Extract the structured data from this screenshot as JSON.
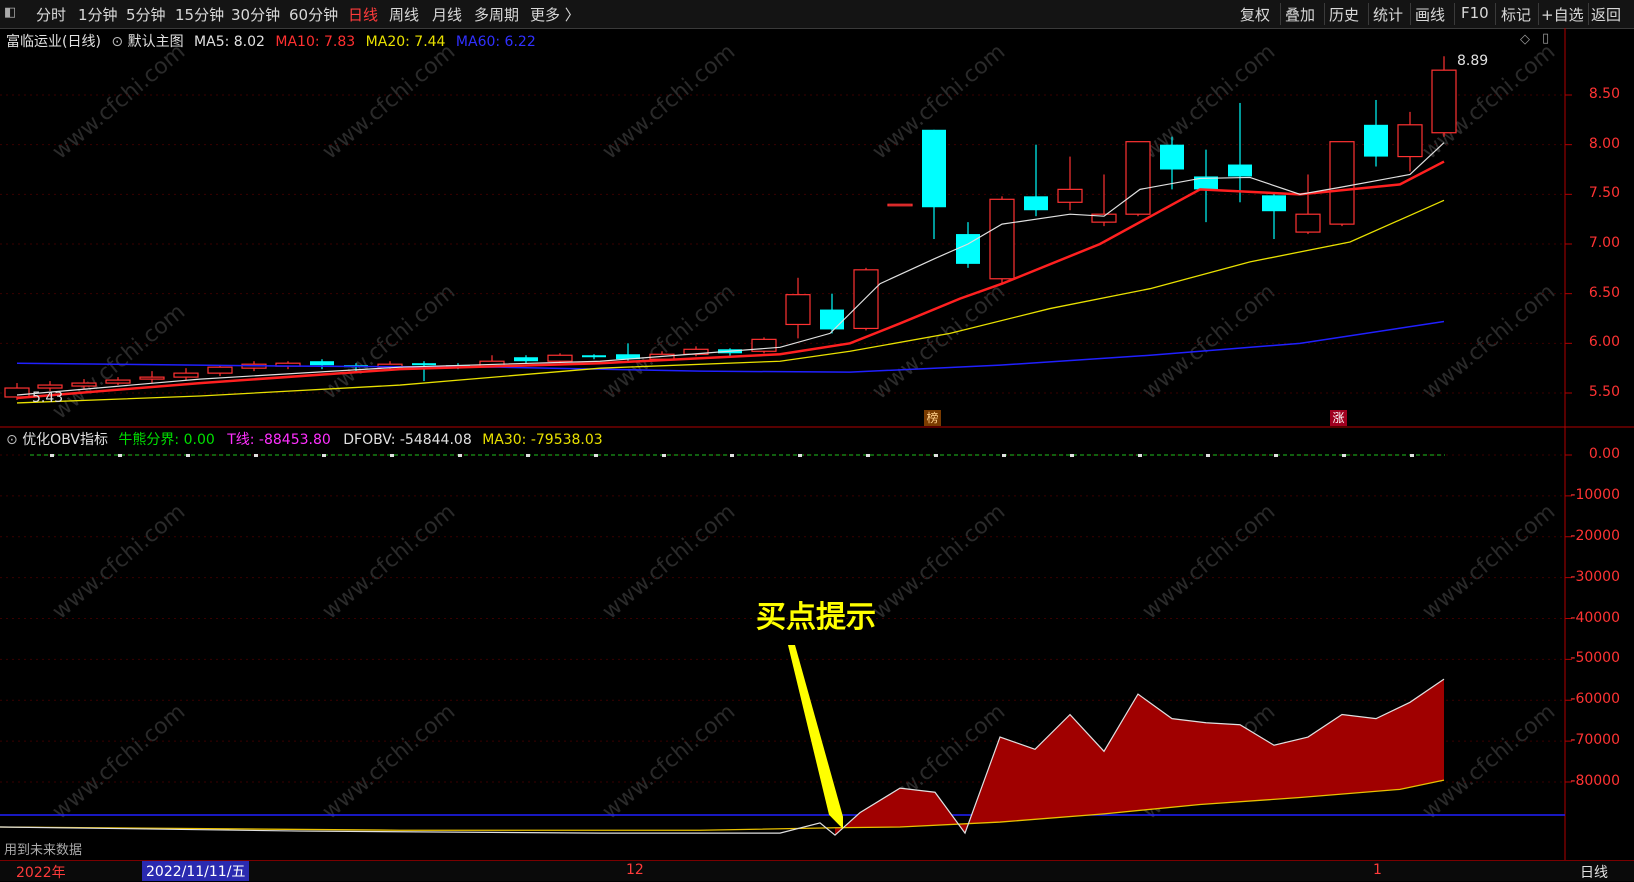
{
  "toolbar": {
    "left_icon": "layout-toggle-icon",
    "periods": [
      "分时",
      "1分钟",
      "5分钟",
      "15分钟",
      "30分钟",
      "60分钟",
      "日线",
      "周线",
      "月线",
      "多周期",
      "更多 〉"
    ],
    "active_period": "日线",
    "right_buttons": [
      "复权",
      "叠加",
      "历史",
      "统计",
      "画线",
      "F10",
      "标记",
      "+自选",
      "返回"
    ]
  },
  "main_chart": {
    "stock_name": "富临运业(日线)",
    "template": "默认主图",
    "ma5": "MA5: 8.02",
    "ma10": "MA10: 7.83",
    "ma20": "MA20: 7.44",
    "ma60": "MA60: 6.22",
    "price_axis": [
      "8.50",
      "8.00",
      "7.50",
      "7.00",
      "6.50",
      "6.00",
      "5.50"
    ],
    "high_marker": "8.89",
    "low_marker": "5.43",
    "badge_1": "榜",
    "badge_2": "涨",
    "colors": {
      "up": "#ff3232",
      "down": "#00ffff",
      "ma5": "#e0e0e0",
      "ma10": "#ff2020",
      "ma20": "#e8e000",
      "ma60": "#2020ff"
    }
  },
  "indicator": {
    "name": "优化OBV指标",
    "bull_label": "牛熊分界: 0.00",
    "t_line": "T线: -88453.80",
    "dfobv": "DFOBV: -54844.08",
    "ma30": "MA30: -79538.03",
    "axis": [
      "0.00",
      "-10000",
      "-20000",
      "-30000",
      "-40000",
      "-50000",
      "-60000",
      "-70000",
      "-80000"
    ],
    "annotation": "买点提示",
    "future_note": "用到未来数据"
  },
  "time_axis": {
    "year_label": "2022年",
    "cursor_date": "2022/11/11/五",
    "month_12": "12",
    "month_1": "1",
    "period_label": "日线"
  },
  "watermark": "www.cfchi.com"
}
